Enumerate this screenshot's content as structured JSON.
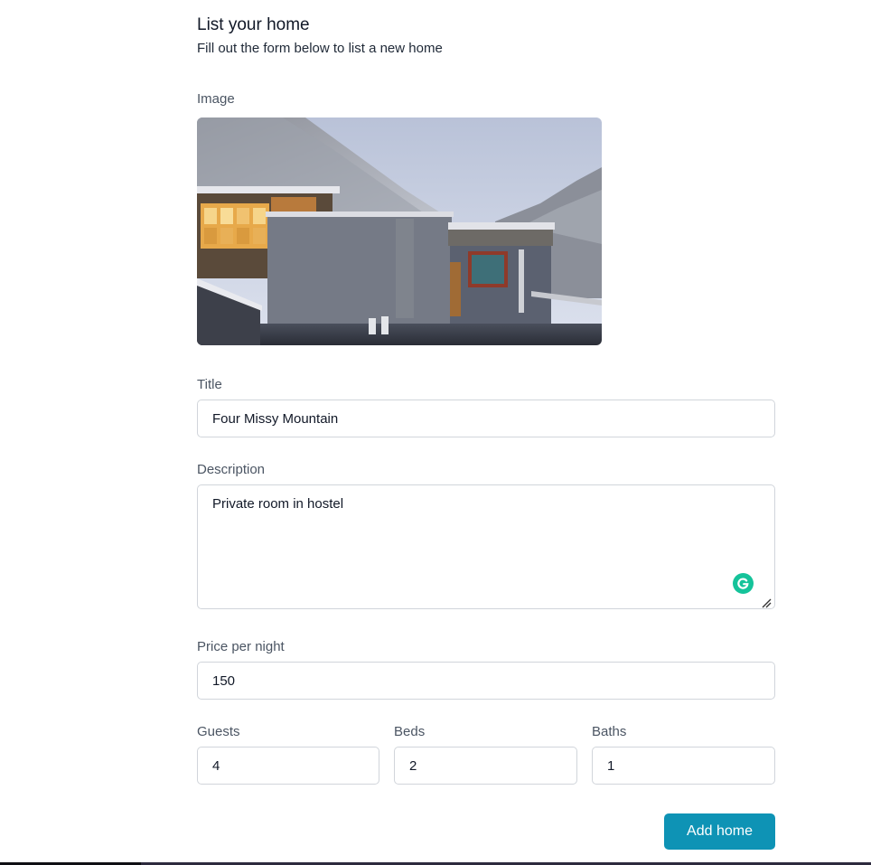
{
  "header": {
    "title": "List your home",
    "subtitle": "Fill out the form below to list a new home"
  },
  "image": {
    "label": "Image"
  },
  "title_field": {
    "label": "Title",
    "value": "Four Missy Mountain"
  },
  "description_field": {
    "label": "Description",
    "value": "Private room in hostel"
  },
  "price_field": {
    "label": "Price per night",
    "value": "150"
  },
  "guests_field": {
    "label": "Guests",
    "value": "4"
  },
  "beds_field": {
    "label": "Beds",
    "value": "2"
  },
  "baths_field": {
    "label": "Baths",
    "value": "1"
  },
  "actions": {
    "submit_label": "Add home"
  },
  "colors": {
    "accent": "#0e93b5",
    "grammarly": "#15c39a"
  }
}
